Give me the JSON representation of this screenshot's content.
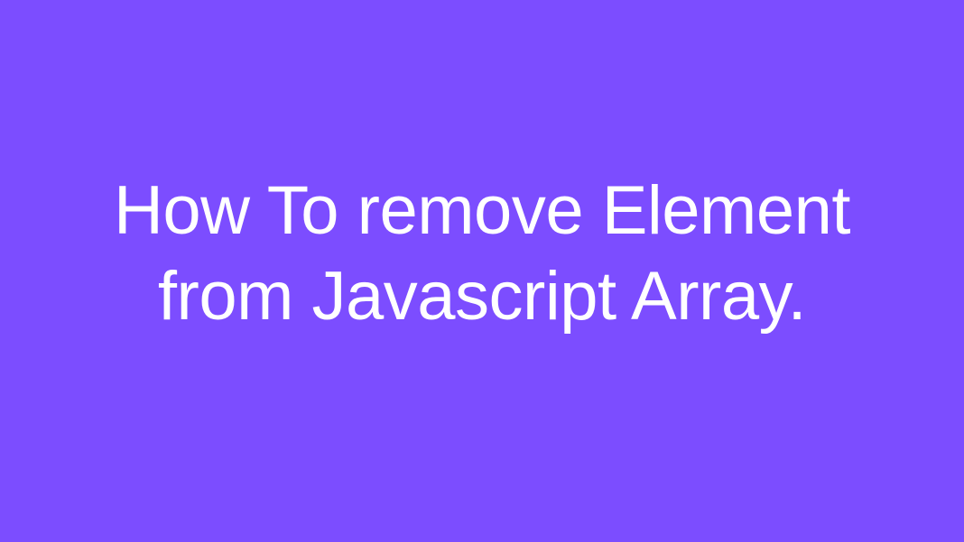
{
  "title": {
    "line1": "How To remove Element",
    "line2": "from Javascript Array."
  },
  "colors": {
    "background": "#7c4dff",
    "text": "#ffffff"
  }
}
